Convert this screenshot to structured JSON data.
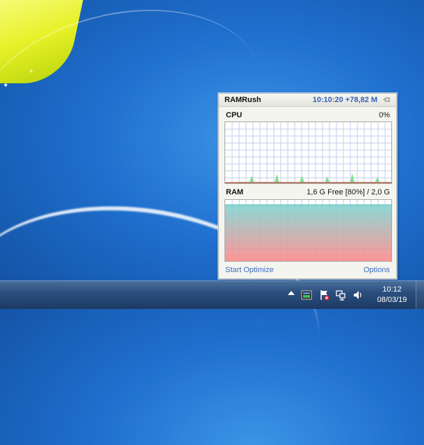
{
  "gadget": {
    "name": "RAMRush",
    "status": "10:10:20 +78,82 M",
    "cpu": {
      "label": "CPU",
      "value": "0%",
      "spikes_percent": [
        0,
        10,
        0,
        13,
        0,
        11,
        0,
        9,
        0,
        14,
        0,
        8
      ]
    },
    "ram": {
      "label": "RAM",
      "value": "1,6 G Free [80%] / 2,0 G",
      "used_fraction": 0.8
    },
    "footer": {
      "start_optimize": "Start Optimize",
      "options": "Options"
    },
    "colors": {
      "status_text": "#3560b5",
      "link": "#3b6bc2",
      "cpu_fill": "#7ee08a",
      "ram_top": "#80d6d2",
      "ram_bottom": "#ff8a8a",
      "grid": "#c5cde8"
    }
  },
  "taskbar": {
    "tray_icons": [
      "show-hidden-icons-arrow",
      "ramrush-tray-icon",
      "action-center-flag-icon",
      "network-icon",
      "volume-icon"
    ],
    "clock": {
      "time": "10:12",
      "date": "08/03/19"
    }
  }
}
